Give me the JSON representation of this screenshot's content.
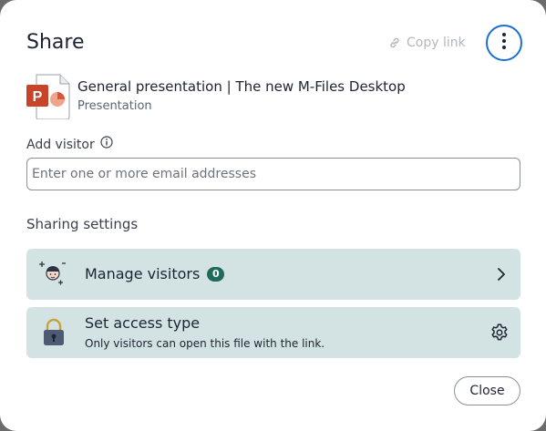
{
  "dialog": {
    "title": "Share",
    "copy_link_label": "Copy link",
    "more_menu": "more-vertical-icon"
  },
  "file": {
    "name": "General presentation | The new M-Files Desktop",
    "type": "Presentation",
    "icon": "powerpoint-file-icon"
  },
  "add_visitor": {
    "label": "Add visitor",
    "placeholder": "Enter one or more email addresses",
    "value": ""
  },
  "sharing_settings": {
    "label": "Sharing settings",
    "manage_visitors": {
      "label": "Manage visitors",
      "count": "0",
      "icon": "visitor-avatar-icon",
      "action_icon": "chevron-right-icon"
    },
    "access_type": {
      "label": "Set access type",
      "description": "Only visitors can open this file with the link.",
      "icon": "lock-icon",
      "action_icon": "gear-icon"
    }
  },
  "footer": {
    "close_label": "Close"
  },
  "colors": {
    "accent": "#1b6fd1",
    "card_background": "#d3e3e3",
    "badge": "#1f6b5d",
    "powerpoint": "#c8432a"
  }
}
